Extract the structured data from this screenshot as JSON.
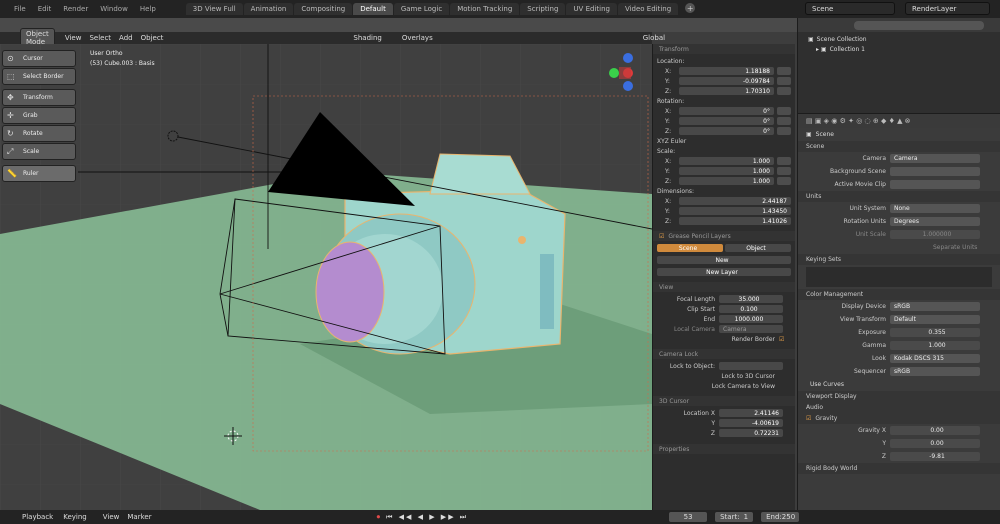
{
  "menu": [
    "File",
    "Edit",
    "Render",
    "Window",
    "Help"
  ],
  "workspace_tabs": [
    "3D View Full",
    "Animation",
    "Compositing",
    "Default",
    "Game Logic",
    "Motion Tracking",
    "Scripting",
    "UV Editing",
    "Video Editing"
  ],
  "active_tab": "Default",
  "scene_selector": "Scene",
  "renderlayer_selector": "RenderLayer",
  "viewport_header": {
    "mode": "Object Mode",
    "menus": [
      "View",
      "Select",
      "Add",
      "Object"
    ],
    "shading": "Shading",
    "overlays": "Overlays",
    "global": "Global"
  },
  "viewport_info": {
    "view": "User Ortho",
    "object": "(53) Cube.003 : Basis"
  },
  "toolbar": [
    "Cursor",
    "Select Border",
    "Transform",
    "Grab",
    "Rotate",
    "Scale",
    "Ruler"
  ],
  "transform_panel": {
    "title": "Transform",
    "location_label": "Location:",
    "location": {
      "x": "1.18188",
      "y": "-0.09784",
      "z": "1.70310"
    },
    "rotation_label": "Rotation:",
    "rotation": {
      "x": "0°",
      "y": "0°",
      "z": "0°"
    },
    "rotation_mode": "XYZ Euler",
    "scale_label": "Scale:",
    "scale": {
      "x": "1.000",
      "y": "1.000",
      "z": "1.000"
    },
    "dimensions_label": "Dimensions:",
    "dimensions": {
      "x": "2.44187",
      "y": "1.43450",
      "z": "1.41026"
    }
  },
  "grease_pencil": {
    "title": "Grease Pencil Layers",
    "scene": "Scene",
    "object": "Object",
    "new": "New",
    "new_layer": "New Layer"
  },
  "view_panel": {
    "title": "View",
    "focal_length_label": "Focal Length",
    "focal_length": "35.000",
    "clip_start_label": "Clip Start",
    "clip_start": "0.100",
    "end_label": "End",
    "end": "1000.000",
    "local_camera_label": "Local Camera",
    "local_camera": "Camera",
    "render_border": "Render Border"
  },
  "camera_lock": {
    "title": "Camera Lock",
    "lock_to_object": "Lock to Object:",
    "lock_to_cursor": "Lock to 3D Cursor",
    "lock_camera": "Lock Camera to View"
  },
  "cursor_panel": {
    "title": "3D Cursor",
    "location_label": "Location X",
    "x": "2.41146",
    "y": "-4.00619",
    "z": "0.72231"
  },
  "properties_label": "Properties",
  "outliner": {
    "scene_collection": "Scene Collection",
    "collection": "Collection 1"
  },
  "scene_props": {
    "scene_name": "Scene",
    "scene_header": "Scene",
    "camera_label": "Camera",
    "camera": "Camera",
    "background_scene_label": "Background Scene",
    "active_clip_label": "Active Movie Clip",
    "units_header": "Units",
    "unit_system_label": "Unit System",
    "unit_system": "None",
    "rotation_units_label": "Rotation Units",
    "rotation_units": "Degrees",
    "unit_scale_label": "Unit Scale",
    "unit_scale": "1.000000",
    "separate_units": "Separate Units",
    "keying_sets_header": "Keying Sets",
    "color_mgmt_header": "Color Management",
    "display_device_label": "Display Device",
    "display_device": "sRGB",
    "view_transform_label": "View Transform",
    "view_transform": "Default",
    "exposure_label": "Exposure",
    "exposure": "0.355",
    "gamma_label": "Gamma",
    "gamma": "1.000",
    "look_label": "Look",
    "look": "Kodak DSCS 315",
    "sequencer_label": "Sequencer",
    "sequencer": "sRGB",
    "use_curves": "Use Curves",
    "viewport_display_header": "Viewport Display",
    "audio_header": "Audio",
    "gravity_header": "Gravity",
    "gravity_x_label": "Gravity X",
    "gravity_x": "0.00",
    "gravity_y_label": "Y",
    "gravity_y": "0.00",
    "gravity_z_label": "Z",
    "gravity_z": "-9.81",
    "rigid_body_header": "Rigid Body World"
  },
  "timeline": {
    "playback": "Playback",
    "keying": "Keying",
    "view": "View",
    "marker": "Marker",
    "current_frame": "53",
    "start_label": "Start:",
    "start": "1",
    "end_label": "End:",
    "end": "250"
  }
}
